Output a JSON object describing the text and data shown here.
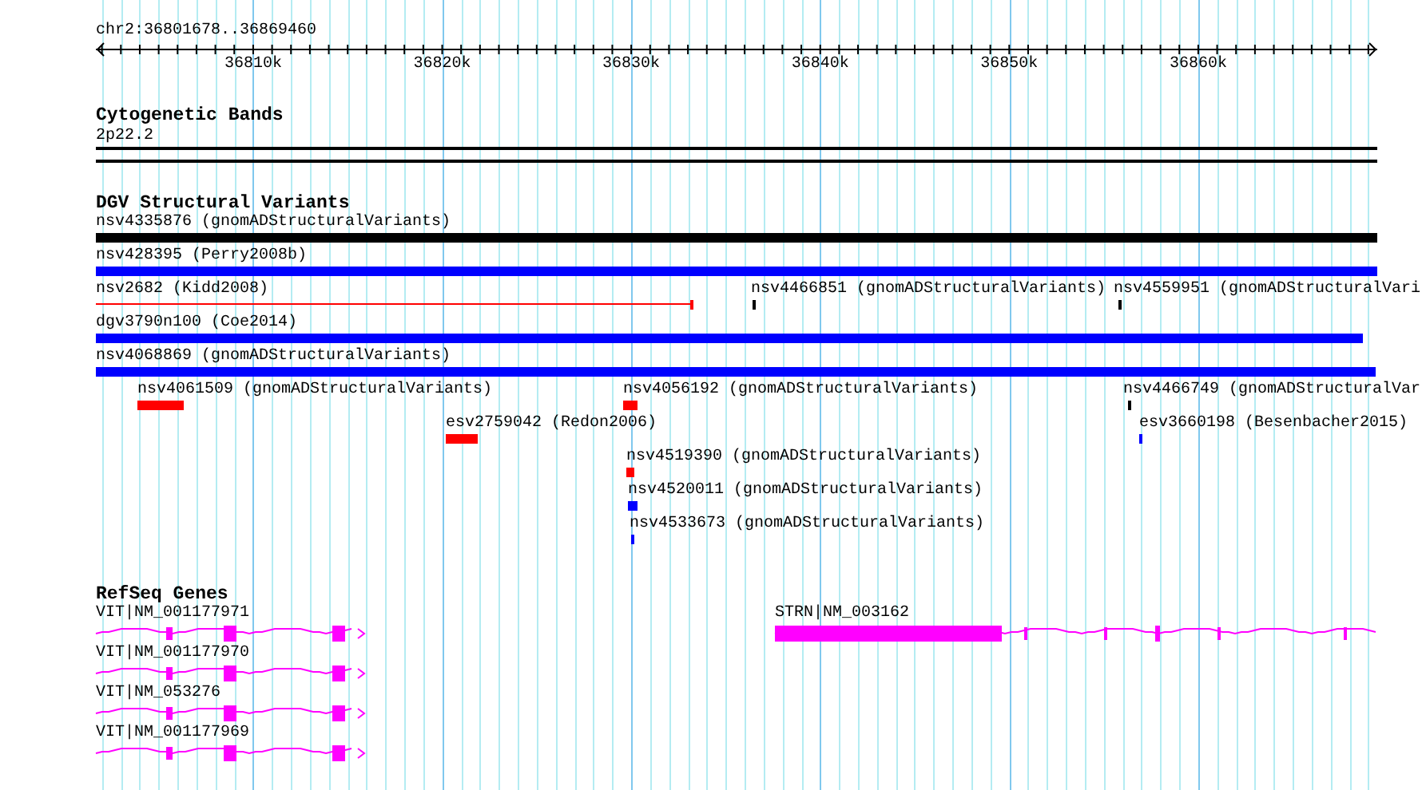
{
  "ruler": {
    "location": "chr2:36801678..36869460",
    "ticks": [
      "36810k",
      "36820k",
      "36830k",
      "36840k",
      "36850k",
      "36860k"
    ]
  },
  "tracks": [
    {
      "kind": "bands",
      "title": "Cytogenetic Bands",
      "features": [
        {
          "label": "2p22.2"
        }
      ]
    },
    {
      "kind": "variants",
      "title": "DGV Structural Variants",
      "features": [
        {
          "label": "nsv4335876 (gnomADStructuralVariants)",
          "kind": "bar",
          "color": "#000000"
        },
        {
          "label": "nsv428395 (Perry2008b)",
          "kind": "bar",
          "color": "#0000ff"
        },
        {
          "label": "nsv2682 (Kidd2008)",
          "kind": "line",
          "color": "#ff0000"
        },
        {
          "label": "nsv4466851 (gnomADStructuralVariants)",
          "kind": "bar",
          "color": "#000000"
        },
        {
          "label": "nsv4559951 (gnomADStructuralVari",
          "kind": "bar",
          "color": "#000000"
        },
        {
          "label": "dgv3790n100 (Coe2014)",
          "kind": "bar",
          "color": "#0000ff"
        },
        {
          "label": "nsv4068869 (gnomADStructuralVariants)",
          "kind": "bar",
          "color": "#0000ff"
        },
        {
          "label": "nsv4061509 (gnomADStructuralVariants)",
          "kind": "bar",
          "color": "#ff0000"
        },
        {
          "label": "nsv4056192 (gnomADStructuralVariants)",
          "kind": "bar",
          "color": "#ff0000"
        },
        {
          "label": "nsv4466749 (gnomADStructuralVar",
          "kind": "bar",
          "color": "#000000"
        },
        {
          "label": "esv2759042 (Redon2006)",
          "kind": "bar",
          "color": "#ff0000"
        },
        {
          "label": "esv3660198 (Besenbacher2015)",
          "kind": "bar",
          "color": "#0000ff"
        },
        {
          "label": "nsv4519390 (gnomADStructuralVariants)",
          "kind": "bar",
          "color": "#ff0000"
        },
        {
          "label": "nsv4520011 (gnomADStructuralVariants)",
          "kind": "bar",
          "color": "#0000ff"
        },
        {
          "label": "nsv4533673 (gnomADStructuralVariants)",
          "kind": "bar",
          "color": "#0000ff"
        }
      ]
    },
    {
      "kind": "genes",
      "title": "RefSeq Genes",
      "features": [
        {
          "label": "VIT|NM_001177971"
        },
        {
          "label": "STRN|NM_003162"
        },
        {
          "label": "VIT|NM_001177970"
        },
        {
          "label": "VIT|NM_053276"
        },
        {
          "label": "VIT|NM_001177969"
        }
      ]
    }
  ]
}
